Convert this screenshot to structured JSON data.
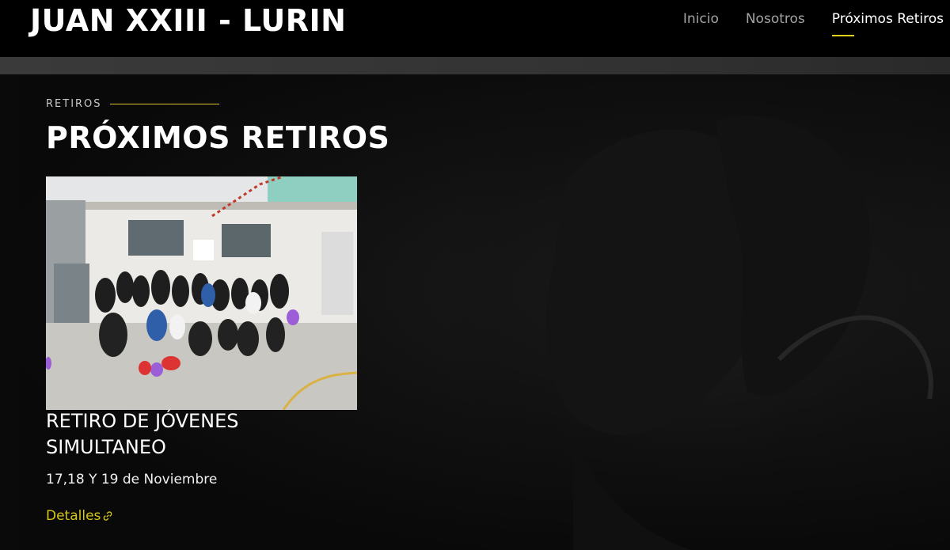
{
  "header": {
    "site_title": "JUAN XXIII - LURIN",
    "nav": [
      {
        "label": "Inicio",
        "active": false
      },
      {
        "label": "Nosotros",
        "active": false
      },
      {
        "label": "Próximos Retiros",
        "active": true
      }
    ],
    "accent_color": "#e0d21a"
  },
  "section": {
    "eyebrow": "RETIROS",
    "title": "PRÓXIMOS RETIROS"
  },
  "card": {
    "image_icon": "group-photo-image",
    "title": "RETIRO DE JÓVENES SIMULTANEO",
    "date": "17,18 Y 19 de Noviembre",
    "link_label": "Detalles",
    "link_icon": "link-icon"
  }
}
